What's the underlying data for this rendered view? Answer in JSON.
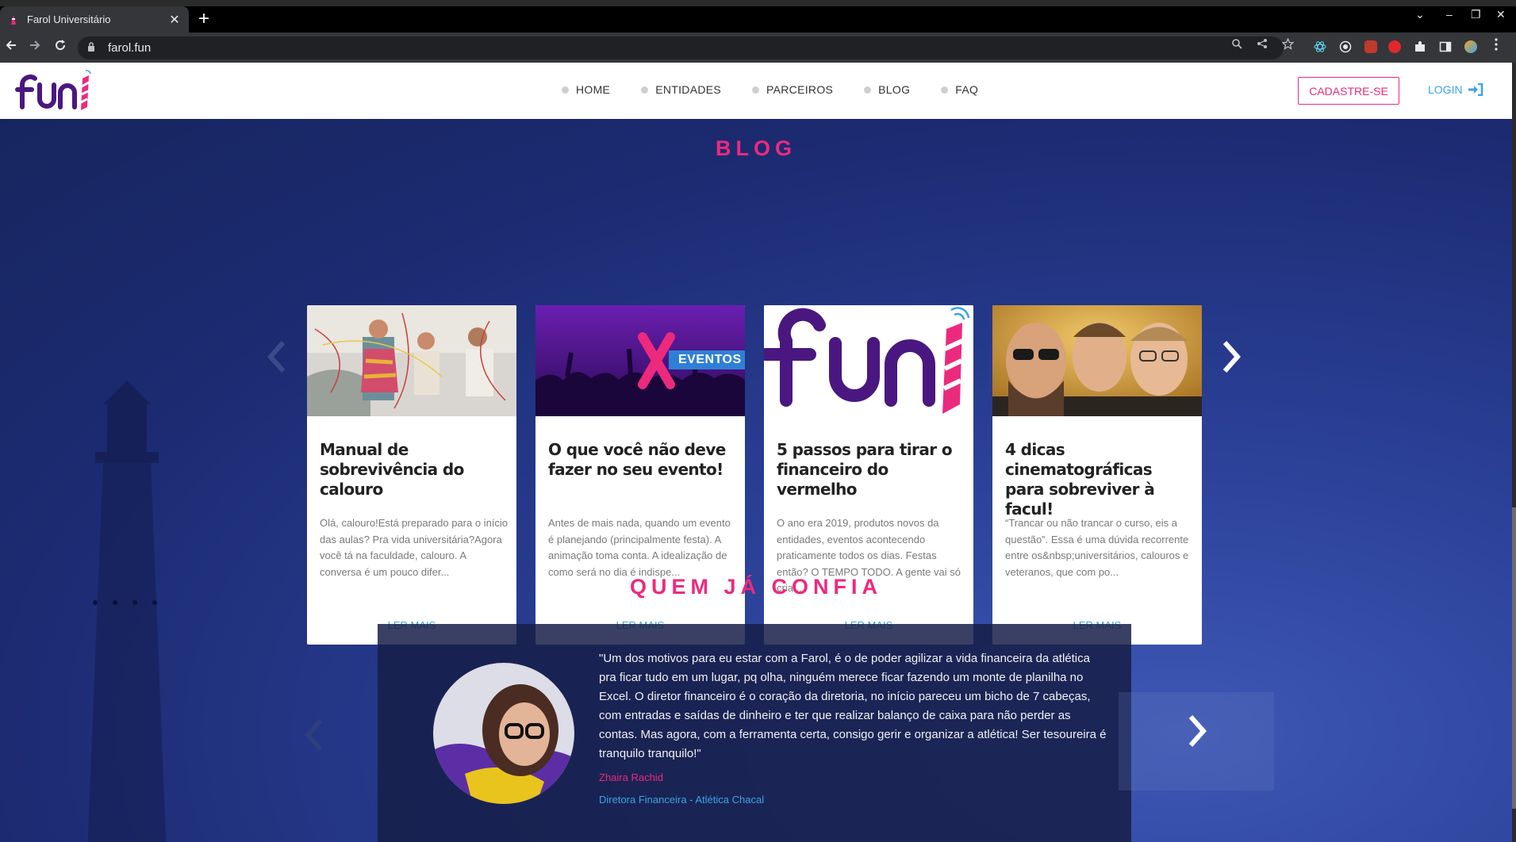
{
  "browser": {
    "tab_title": "Farol Universitário",
    "tab_close": "✕",
    "new_tab": "+",
    "url": "farol.fun",
    "controls": {
      "minimize": "–",
      "restore": "❐",
      "close": "✕",
      "tab_search": "⌄"
    }
  },
  "header": {
    "menu": [
      {
        "label": "HOME"
      },
      {
        "label": "ENTIDADES"
      },
      {
        "label": "PARCEIROS"
      },
      {
        "label": "BLOG"
      },
      {
        "label": "FAQ"
      }
    ],
    "signup_label": "CADASTRE-SE",
    "login_label": "LOGIN"
  },
  "blog": {
    "title": "BLOG",
    "posts": [
      {
        "title": "Manual de sobrevivência do calouro",
        "excerpt": "Olá, calouro!Está preparado para o início das aulas? Pra vida universitária?Agora você tá na faculdade, calouro. A conversa é um pouco difer...",
        "read_more": "LER MAIS"
      },
      {
        "title": "O que você não deve fazer no seu evento!",
        "excerpt": "Antes de mais nada, quando um evento é planejando (principalmente festa). A animação toma conta. A idealização de como será no dia é indispe...",
        "read_more": "LER MAIS",
        "image_text": "EVENTOS"
      },
      {
        "title": "5 passos para tirar o financeiro do vermelho",
        "excerpt": "O ano era 2019, produtos novos da entidades, eventos acontecendo praticamente todos os dias. Festas então? O TEMPO TODO. A gente vai só cria...",
        "read_more": "LER MAIS"
      },
      {
        "title": "4 dicas cinematográficas para sobreviver à facul!",
        "excerpt": "“Trancar ou não trancar o curso, eis a questão”. Essa é uma dúvida recorrente entre os&nbsp;universitários, calouros e veteranos, que com po...",
        "read_more": "LER MAIS"
      }
    ]
  },
  "testimonials": {
    "title": "QUEM JÁ CONFIA",
    "quote": "\"Um dos motivos para eu estar com a Farol, é o de poder agilizar a vida financeira da atlética pra ficar tudo em um lugar, pq olha, ninguém merece ficar fazendo um monte de planilha no Excel. O diretor financeiro é o coração da diretoria, no início pareceu um bicho de 7 cabeças, com entradas e saídas de dinheiro e ter que realizar balanço de caixa para não perder as contas. Mas agora, com a ferramenta certa, consigo gerir e organizar a atlética! Ser tesoureira é tranquilo tranquilo!\"",
    "name": "Zhaira Rachid",
    "role": "Diretora Financeira - Atlética Chacal"
  },
  "colors": {
    "accent_pink": "#ec2a7d",
    "accent_blue": "#3ba3e6",
    "brand_purple": "#4a1780",
    "background_navy": "#1c2b72"
  }
}
